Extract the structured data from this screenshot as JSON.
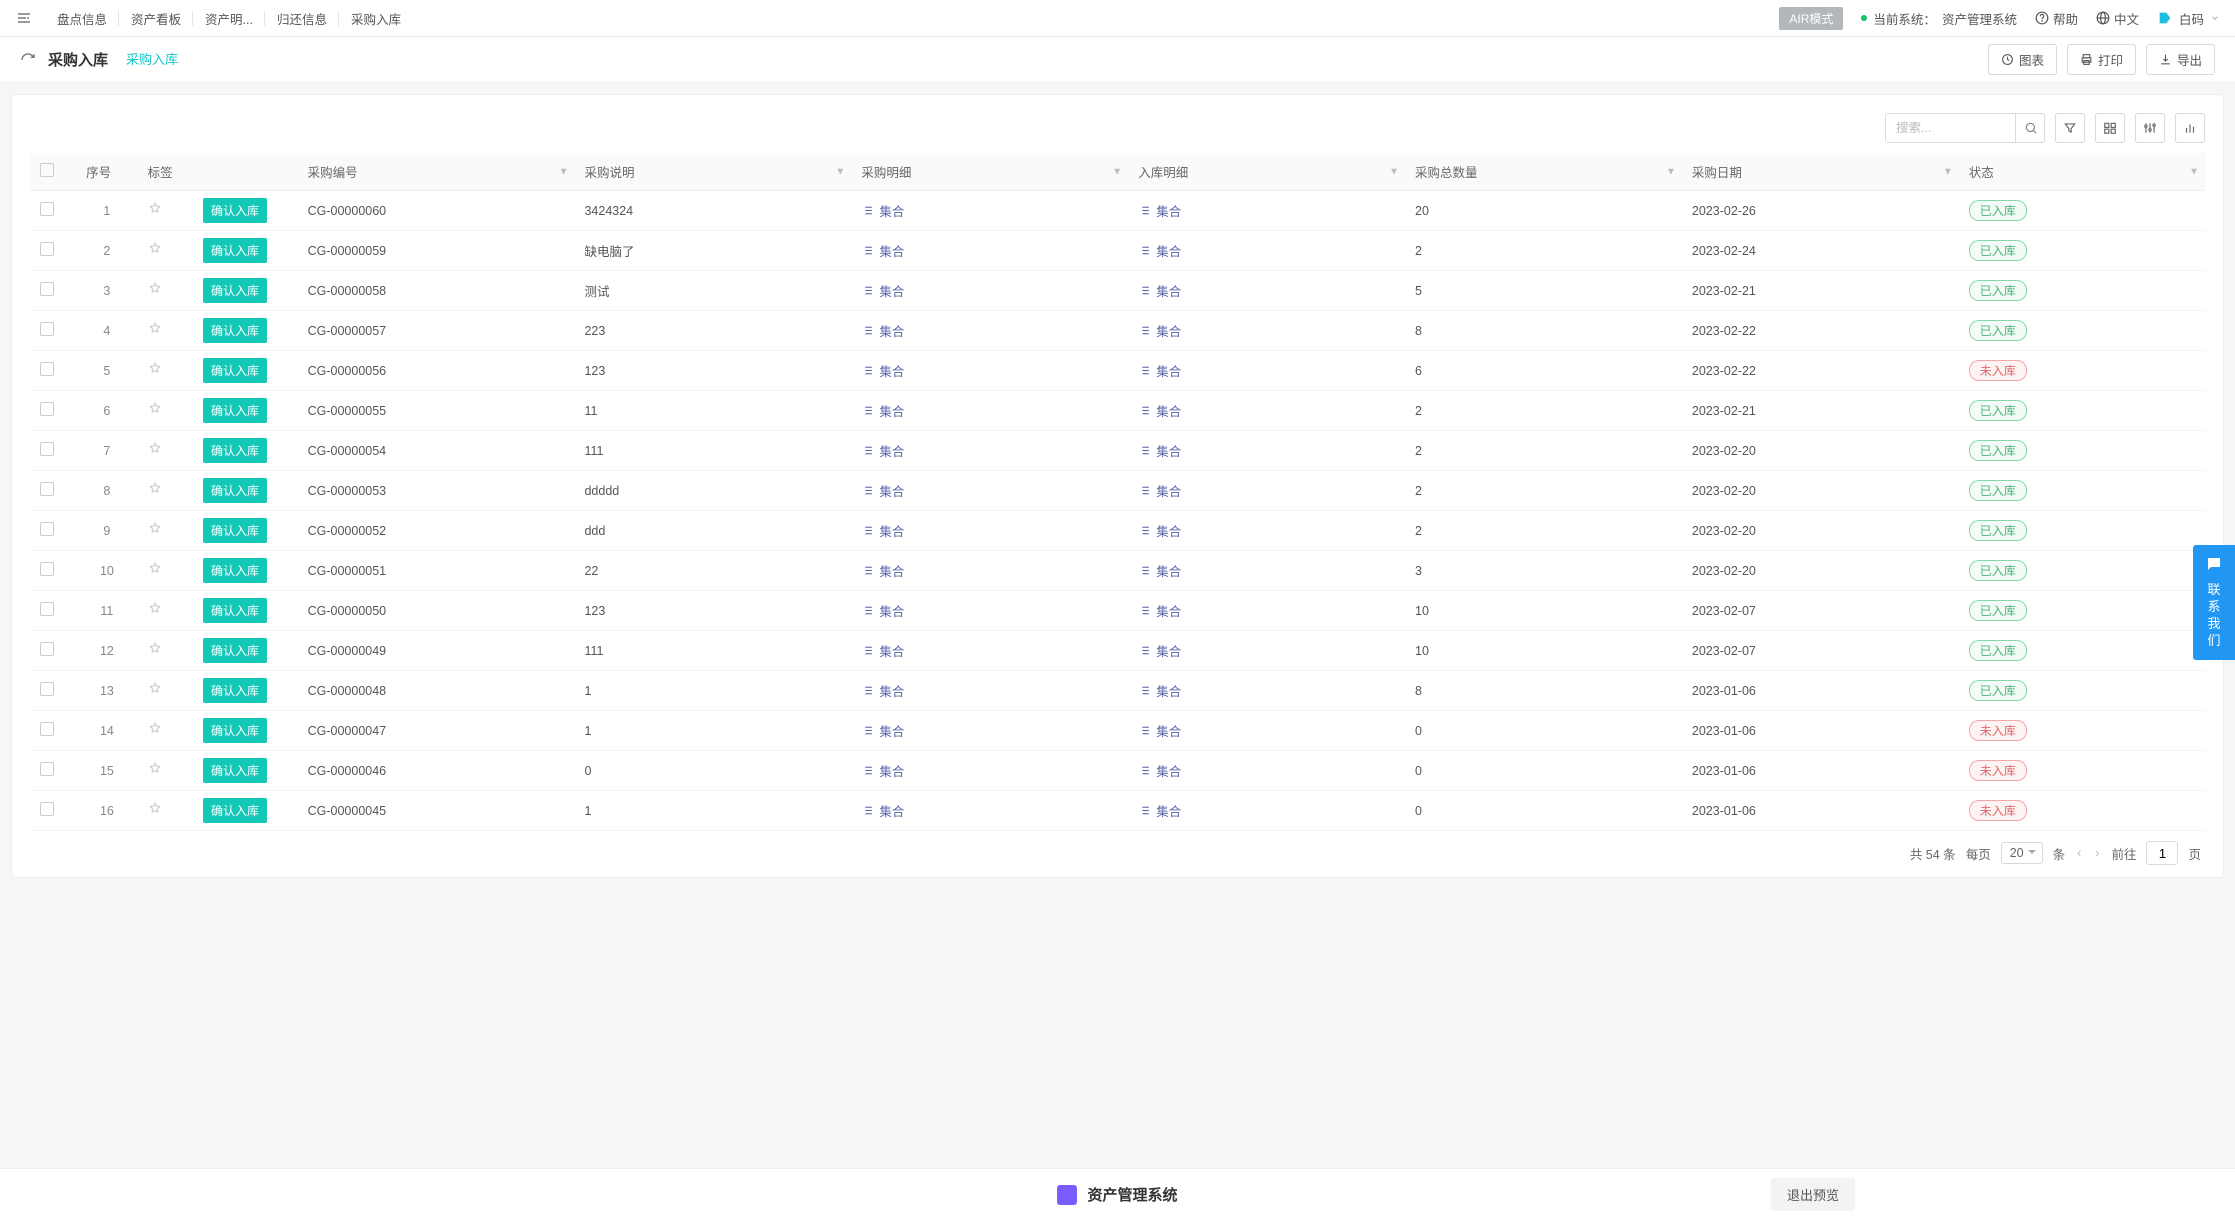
{
  "topnav": {
    "items": [
      "盘点信息",
      "资产看板",
      "资产明...",
      "归还信息",
      "采购入库"
    ],
    "air_mode": "AIR模式",
    "system_prefix": "当前系统：",
    "system_name": "资产管理系统",
    "help": "帮助",
    "lang": "中文",
    "brand": "白码"
  },
  "subhead": {
    "title": "采购入库",
    "tab": "采购入库",
    "chart": "图表",
    "print": "打印",
    "export": "导出"
  },
  "toolbar": {
    "search_placeholder": "搜索..."
  },
  "table": {
    "headers": {
      "index": "序号",
      "tag": "标签",
      "pno": "采购编号",
      "desc": "采购说明",
      "detail": "采购明细",
      "indetail": "入库明细",
      "total": "采购总数量",
      "date": "采购日期",
      "status": "状态"
    },
    "confirm_label": "确认入库",
    "set_label": "集合",
    "status_in": "已入库",
    "status_out": "未入库",
    "rows": [
      {
        "idx": "1",
        "pno": "CG-00000060",
        "desc": "3424324",
        "total": "20",
        "date": "2023-02-26",
        "status": "in"
      },
      {
        "idx": "2",
        "pno": "CG-00000059",
        "desc": "缺电脑了",
        "total": "2",
        "date": "2023-02-24",
        "status": "in"
      },
      {
        "idx": "3",
        "pno": "CG-00000058",
        "desc": "测试",
        "total": "5",
        "date": "2023-02-21",
        "status": "in"
      },
      {
        "idx": "4",
        "pno": "CG-00000057",
        "desc": "223",
        "total": "8",
        "date": "2023-02-22",
        "status": "in"
      },
      {
        "idx": "5",
        "pno": "CG-00000056",
        "desc": "123",
        "total": "6",
        "date": "2023-02-22",
        "status": "out"
      },
      {
        "idx": "6",
        "pno": "CG-00000055",
        "desc": "11",
        "total": "2",
        "date": "2023-02-21",
        "status": "in"
      },
      {
        "idx": "7",
        "pno": "CG-00000054",
        "desc": "111",
        "total": "2",
        "date": "2023-02-20",
        "status": "in"
      },
      {
        "idx": "8",
        "pno": "CG-00000053",
        "desc": "ddddd",
        "total": "2",
        "date": "2023-02-20",
        "status": "in"
      },
      {
        "idx": "9",
        "pno": "CG-00000052",
        "desc": "ddd",
        "total": "2",
        "date": "2023-02-20",
        "status": "in"
      },
      {
        "idx": "10",
        "pno": "CG-00000051",
        "desc": "22",
        "total": "3",
        "date": "2023-02-20",
        "status": "in"
      },
      {
        "idx": "11",
        "pno": "CG-00000050",
        "desc": "123",
        "total": "10",
        "date": "2023-02-07",
        "status": "in"
      },
      {
        "idx": "12",
        "pno": "CG-00000049",
        "desc": "111",
        "total": "10",
        "date": "2023-02-07",
        "status": "in"
      },
      {
        "idx": "13",
        "pno": "CG-00000048",
        "desc": "1",
        "total": "8",
        "date": "2023-01-06",
        "status": "in"
      },
      {
        "idx": "14",
        "pno": "CG-00000047",
        "desc": "1",
        "total": "0",
        "date": "2023-01-06",
        "status": "out"
      },
      {
        "idx": "15",
        "pno": "CG-00000046",
        "desc": "0",
        "total": "0",
        "date": "2023-01-06",
        "status": "out"
      },
      {
        "idx": "16",
        "pno": "CG-00000045",
        "desc": "1",
        "total": "0",
        "date": "2023-01-06",
        "status": "out"
      }
    ]
  },
  "pager": {
    "total_text": "共 54 条",
    "per_page_label": "每页",
    "per_page_value": "20",
    "unit": "条",
    "goto_label": "前往",
    "goto_value": "1",
    "page_unit": "页"
  },
  "footer": {
    "brand": "资产管理系统",
    "exit": "退出预览"
  },
  "contact": {
    "text": "联系我们"
  }
}
